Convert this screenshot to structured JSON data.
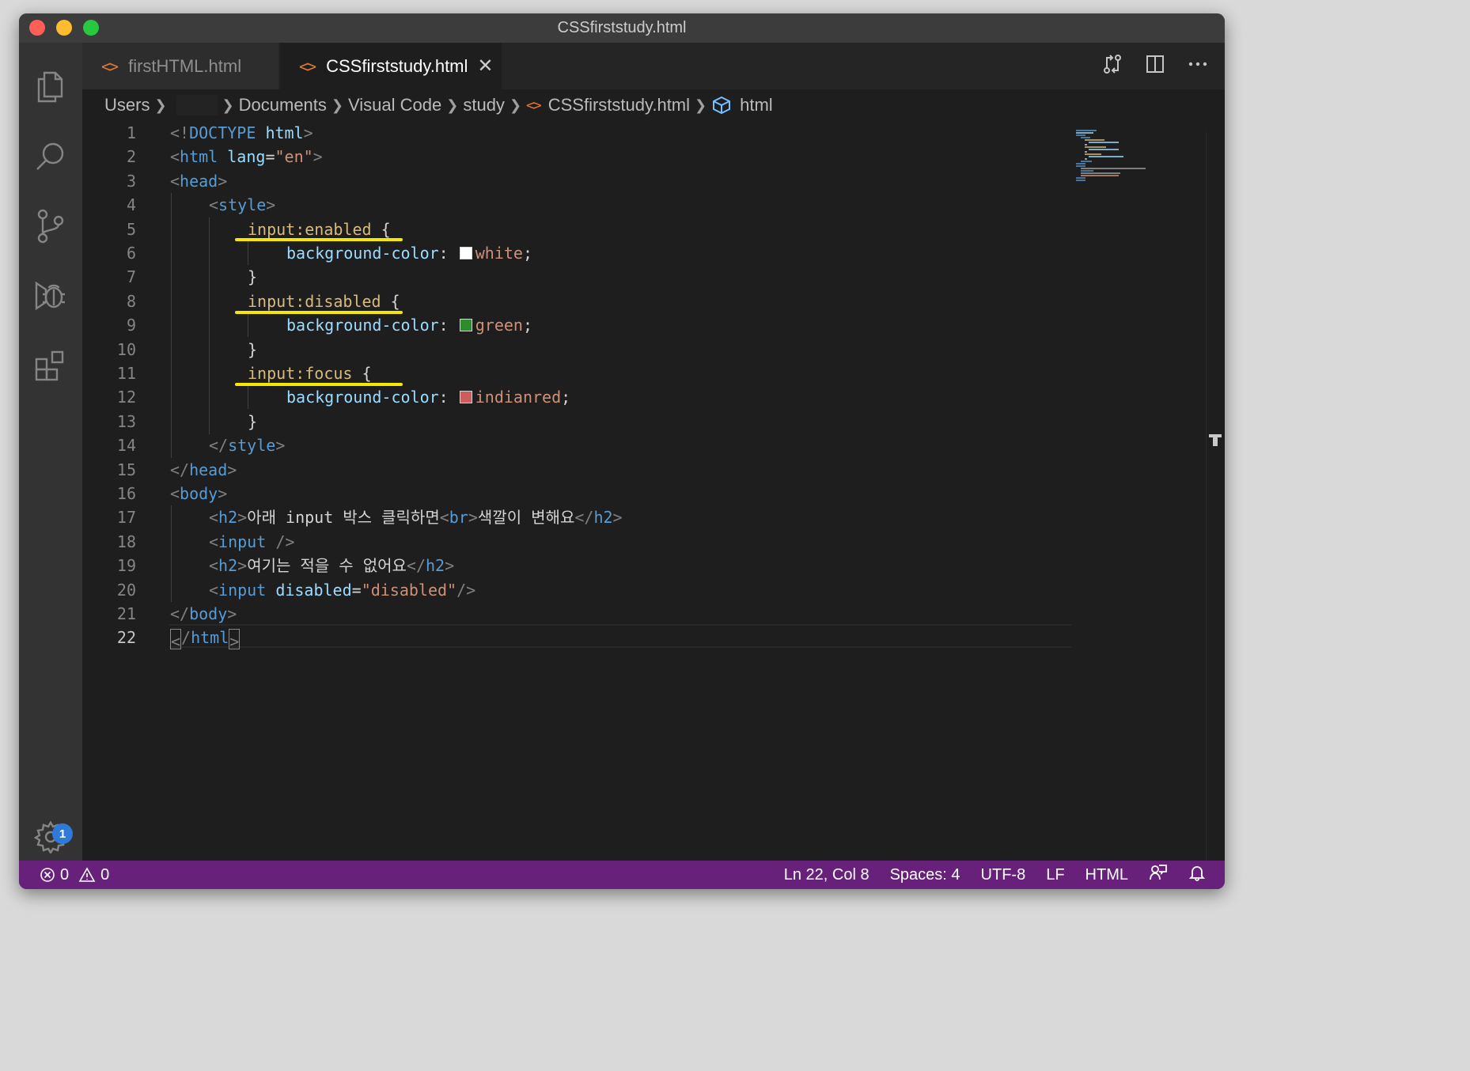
{
  "window": {
    "title": "CSSfirststudy.html"
  },
  "tabs": [
    {
      "label": "firstHTML.html",
      "icon": "html-file-icon",
      "active": false
    },
    {
      "label": "CSSfirststudy.html",
      "icon": "html-file-icon",
      "active": true,
      "close": "✕"
    }
  ],
  "breadcrumb": {
    "items": [
      "Users",
      "Documents",
      "Visual Code",
      "study",
      "CSSfirststudy.html",
      "html"
    ]
  },
  "editor": {
    "line_numbers": [
      "1",
      "2",
      "3",
      "4",
      "5",
      "6",
      "7",
      "8",
      "9",
      "10",
      "11",
      "12",
      "13",
      "14",
      "15",
      "16",
      "17",
      "18",
      "19",
      "20",
      "21",
      "22"
    ],
    "current_line": "22",
    "code": {
      "doctype_open": "<!",
      "doctype_kw": "DOCTYPE",
      "doctype_html": "html",
      "lt": "<",
      "gt": ">",
      "lt_slash": "</",
      "self_close": "/>",
      "html_tag": "html",
      "lang_attr": "lang",
      "eq": "=",
      "lang_val": "\"en\"",
      "head_tag": "head",
      "style_tag": "style",
      "sel_enabled": "input:enabled",
      "sel_disabled": "input:disabled",
      "sel_focus": "input:focus",
      "brace_open": " {",
      "brace_close": "}",
      "prop": "background-color",
      "colon": ": ",
      "semi": ";",
      "val_white": "white",
      "val_green": "green",
      "val_indianred": "indianred",
      "body_tag": "body",
      "h2_tag": "h2",
      "br_tag": "br",
      "input_tag": "input",
      "h2_text_a": "아래 input 박스 클릭하면",
      "h2_text_b": "색깔이 변해요",
      "h2_text_c": "여기는 적을 수 없어요",
      "disabled_attr": "disabled",
      "disabled_val": "\"disabled\"",
      "space": " "
    },
    "swatch_colors": {
      "white": "#ffffff",
      "green": "#2e8b2e",
      "indianred": "#cd5c5c"
    }
  },
  "statusbar": {
    "errors": "0",
    "warnings": "0",
    "position": "Ln 22, Col 8",
    "spaces": "Spaces: 4",
    "encoding": "UTF-8",
    "eol": "LF",
    "language": "HTML"
  },
  "settings_badge": "1",
  "colors": {
    "status_bar": "#68217a",
    "annotation_underline": "#f5e800"
  }
}
